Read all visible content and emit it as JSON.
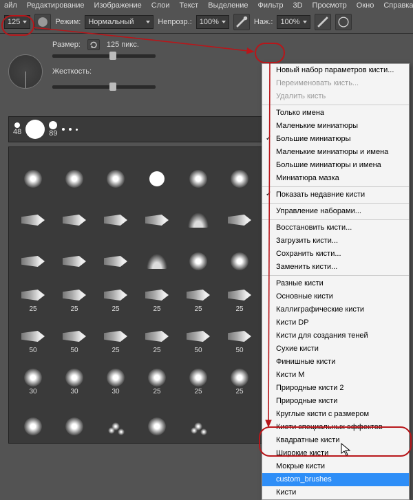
{
  "menubar": [
    "айл",
    "Редактирование",
    "Изображение",
    "Слои",
    "Текст",
    "Выделение",
    "Фильтр",
    "3D",
    "Просмотр",
    "Окно",
    "Справка"
  ],
  "toolbar": {
    "brush_size": "125",
    "mode_label": "Режим:",
    "mode_value": "Нормальный",
    "opacity_label": "Непрозр.:",
    "opacity_value": "100%",
    "flow_label": "Наж.:",
    "flow_value": "100%"
  },
  "panel": {
    "size_label": "Размер:",
    "size_value": "125 пикс.",
    "hardness_label": "Жесткость:"
  },
  "strip": {
    "labels": [
      "48",
      "",
      "89",
      "",
      "",
      ""
    ]
  },
  "grid": {
    "rows": [
      [
        {
          "t": "round"
        },
        {
          "t": "round"
        },
        {
          "t": "round"
        },
        {
          "t": "hard"
        },
        {
          "t": "round"
        },
        {
          "t": "round"
        }
      ],
      [
        {
          "t": "tip"
        },
        {
          "t": "tip"
        },
        {
          "t": "tip"
        },
        {
          "t": "tip"
        },
        {
          "t": "fan"
        },
        {
          "t": "tip"
        }
      ],
      [
        {
          "t": "tip"
        },
        {
          "t": "tip"
        },
        {
          "t": "tip"
        },
        {
          "t": "fan"
        },
        {
          "t": "round"
        },
        {
          "t": "round"
        }
      ],
      [
        {
          "t": "tip",
          "n": "25"
        },
        {
          "t": "tip",
          "n": "25"
        },
        {
          "t": "tip",
          "n": "25"
        },
        {
          "t": "tip",
          "n": "25"
        },
        {
          "t": "tip",
          "n": "25"
        },
        {
          "t": "tip",
          "n": "25"
        }
      ],
      [
        {
          "t": "tip",
          "n": "50"
        },
        {
          "t": "tip",
          "n": "50"
        },
        {
          "t": "tip",
          "n": "25"
        },
        {
          "t": "tip",
          "n": "25"
        },
        {
          "t": "tip",
          "n": "50"
        },
        {
          "t": "tip",
          "n": "50"
        }
      ],
      [
        {
          "t": "round",
          "n": "30"
        },
        {
          "t": "round",
          "n": "30"
        },
        {
          "t": "round",
          "n": "30"
        },
        {
          "t": "round",
          "n": "25"
        },
        {
          "t": "round",
          "n": "25"
        },
        {
          "t": "round",
          "n": "25"
        }
      ],
      [
        {
          "t": "round"
        },
        {
          "t": "round"
        },
        {
          "t": "spark"
        },
        {
          "t": "round"
        },
        {
          "t": "spark"
        },
        {
          "t": ""
        }
      ]
    ]
  },
  "menu": {
    "groups": [
      [
        {
          "label": "Новый набор параметров кисти..."
        },
        {
          "label": "Переименовать кисть...",
          "disabled": true
        },
        {
          "label": "Удалить кисть",
          "disabled": true
        }
      ],
      [
        {
          "label": "Только имена"
        },
        {
          "label": "Маленькие миниатюры"
        },
        {
          "label": "Большие миниатюры",
          "checked": true
        },
        {
          "label": "Маленькие миниатюры и имена"
        },
        {
          "label": "Большие миниатюры и имена"
        },
        {
          "label": "Миниатюра мазка"
        }
      ],
      [
        {
          "label": "Показать недавние кисти",
          "checked": true
        }
      ],
      [
        {
          "label": "Управление наборами..."
        }
      ],
      [
        {
          "label": "Восстановить кисти..."
        },
        {
          "label": "Загрузить кисти..."
        },
        {
          "label": "Сохранить кисти..."
        },
        {
          "label": "Заменить кисти..."
        }
      ],
      [
        {
          "label": "Разные кисти"
        },
        {
          "label": "Основные кисти"
        },
        {
          "label": "Каллиграфические кисти"
        },
        {
          "label": "Кисти DP"
        },
        {
          "label": "Кисти для создания теней"
        },
        {
          "label": "Сухие кисти"
        },
        {
          "label": "Финишные кисти"
        },
        {
          "label": "Кисти M"
        },
        {
          "label": "Природные кисти 2"
        },
        {
          "label": "Природные кисти"
        },
        {
          "label": "Круглые кисти с размером"
        },
        {
          "label": "Кисти специальных эффектов"
        },
        {
          "label": "Квадратные кисти"
        },
        {
          "label": "Широкие кисти"
        },
        {
          "label": "Мокрые кисти"
        },
        {
          "label": "custom_brushes",
          "highlight": true
        },
        {
          "label": "Кисти"
        }
      ]
    ]
  }
}
